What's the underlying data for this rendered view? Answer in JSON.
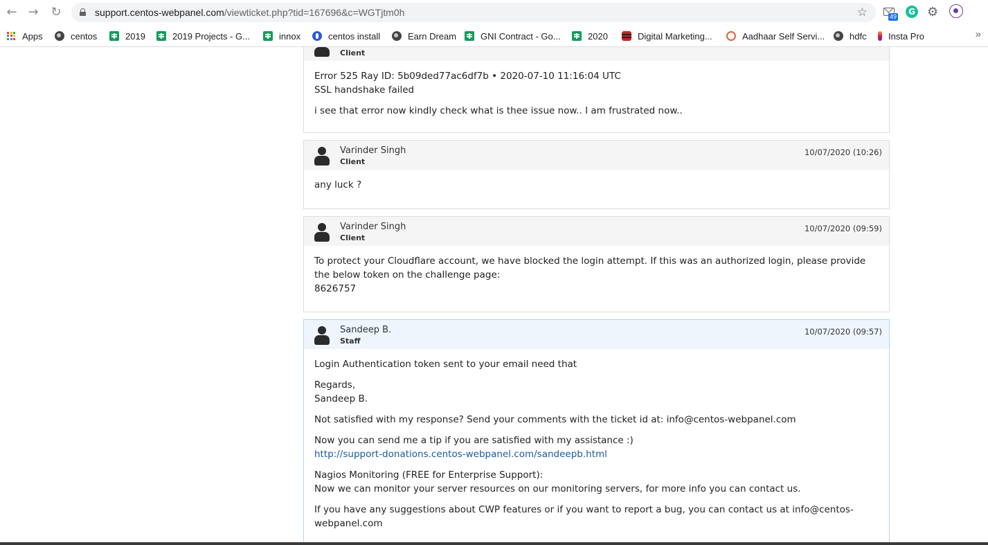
{
  "browser": {
    "url_host": "support.centos-webpanel.com",
    "url_path": "/viewticket.php?tid=167696&c=WGTjtm0h",
    "mail_badge": "49",
    "grammarly_letter": "G"
  },
  "bookmarks": [
    {
      "label": "Apps",
      "icon": "apps-icon"
    },
    {
      "label": "centos",
      "icon": "globe-icon"
    },
    {
      "label": "2019",
      "icon": "sheets-icon"
    },
    {
      "label": "2019 Projects - G...",
      "icon": "sheets-icon"
    },
    {
      "label": "innox",
      "icon": "sheets-icon"
    },
    {
      "label": "centos install",
      "icon": "shield-icon"
    },
    {
      "label": "Earn Dream",
      "icon": "globe-icon"
    },
    {
      "label": "GNI Contract - Go...",
      "icon": "sheets-icon"
    },
    {
      "label": "2020",
      "icon": "sheets-icon"
    },
    {
      "label": "Digital Marketing...",
      "icon": "database-icon"
    },
    {
      "label": "Aadhaar Self Servi...",
      "icon": "fingerprint-icon"
    },
    {
      "label": "hdfc",
      "icon": "globe-icon"
    },
    {
      "label": "Insta Pro",
      "icon": "instagram-icon"
    }
  ],
  "messages": [
    {
      "role": "Client",
      "lines": [
        "Error 525 Ray ID: 5b09ded77ac6df7b • 2020-07-10 11:16:04 UTC",
        "SSL handshake failed",
        "i see that error now kindly check what is thee issue now.. I am frustrated now.."
      ]
    },
    {
      "author": "Varinder Singh",
      "role": "Client",
      "date": "10/07/2020 (10:26)",
      "lines": [
        "any luck ?"
      ]
    },
    {
      "author": "Varinder Singh",
      "role": "Client",
      "date": "10/07/2020 (09:59)",
      "lines": [
        "To protect your Cloudflare account, we have blocked the login attempt. If this was an authorized login, please provide the below token on the challenge page:",
        "8626757"
      ]
    },
    {
      "author": "Sandeep B.",
      "role": "Staff",
      "date": "10/07/2020 (09:57)",
      "lines": [
        "Login Authentication token sent to your email need that",
        "Regards,",
        "Sandeep B.",
        "Not satisfied with my response? Send your comments with the ticket id at: info@centos-webpanel.com",
        "Now you can send me a tip if you are satisfied with my assistance :)",
        "http://support-donations.centos-webpanel.com/sandeepb.html",
        "Nagios Monitoring (FREE for Enterprise Support):",
        "Now we can monitor your server resources on our monitoring servers, for more info you can contact us.",
        "If you have any suggestions about CWP features or if you want to report a bug, you can contact us at info@centos-webpanel.com"
      ]
    }
  ]
}
